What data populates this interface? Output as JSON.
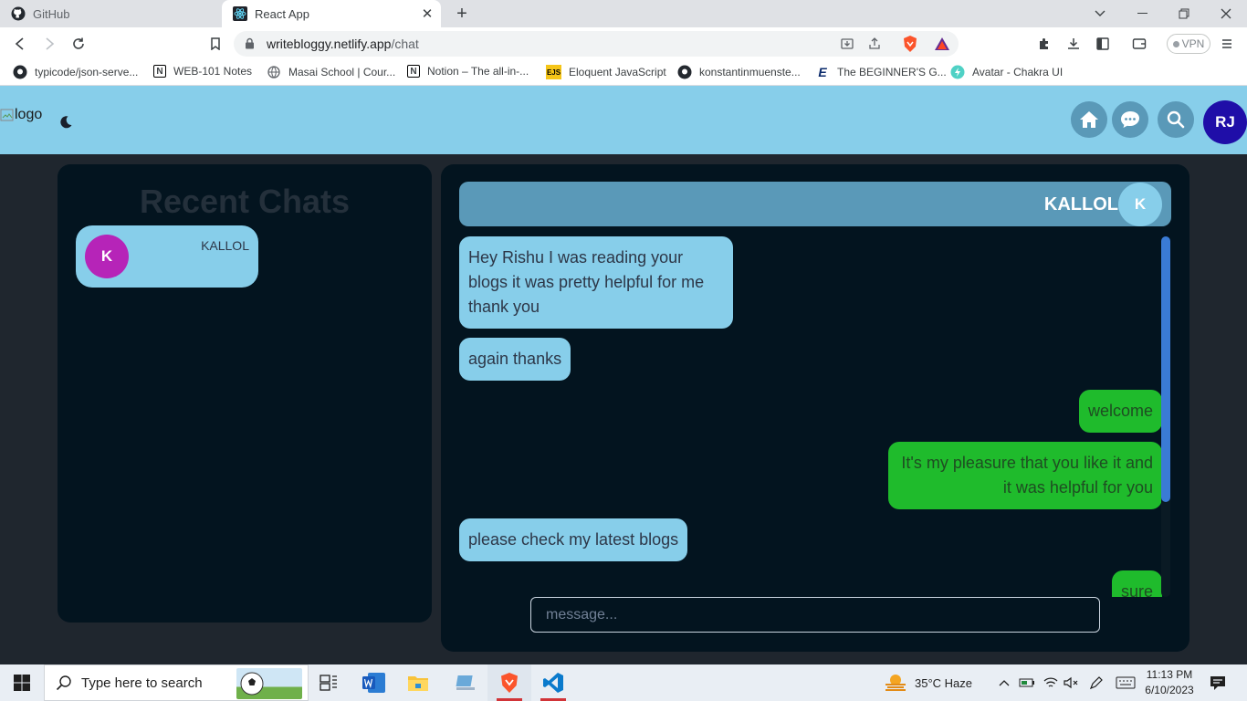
{
  "browser": {
    "tabs": [
      {
        "title": "GitHub",
        "icon": "github-icon",
        "active": false
      },
      {
        "title": "React App",
        "icon": "react-icon",
        "active": true
      }
    ],
    "url_host": "writebloggy.netlify.app",
    "url_path": "/chat",
    "vpn_label": "VPN",
    "bookmarks": [
      {
        "label": "typicode/json-serve...",
        "icon": "github-icon"
      },
      {
        "label": "WEB-101 Notes",
        "icon": "notion-icon"
      },
      {
        "label": "Masai School | Cour...",
        "icon": "globe-icon"
      },
      {
        "label": "Notion – The all-in-...",
        "icon": "notion-icon"
      },
      {
        "label": "Eloquent JavaScript",
        "icon": "ejs-icon"
      },
      {
        "label": "konstantinmuenste...",
        "icon": "github-icon"
      },
      {
        "label": "The BEGINNER'S G...",
        "icon": "e-icon"
      },
      {
        "label": "Avatar - Chakra UI",
        "icon": "chakra-icon"
      }
    ]
  },
  "app": {
    "logo_alt": "logo",
    "user_initials": "RJ",
    "recent_chats_title": "Recent Chats",
    "recent_chats": [
      {
        "initial": "K",
        "name": "KALLOL"
      }
    ],
    "active_chat": {
      "name": "KALLOL",
      "initial": "K",
      "messages": [
        {
          "from": "them",
          "text": "Hey Rishu I was reading your blogs it was pretty helpful for me thank you"
        },
        {
          "from": "them",
          "text": "again thanks"
        },
        {
          "from": "me",
          "text": "welcome"
        },
        {
          "from": "me",
          "text": "It's my pleasure that you like it and it was helpful for you"
        },
        {
          "from": "them",
          "text": "please check my latest blogs"
        },
        {
          "from": "me",
          "text": "sure"
        }
      ]
    },
    "message_placeholder": "message...",
    "message_value": ""
  },
  "colors": {
    "header_bg": "#87ceea",
    "panel_bg": "#03141f",
    "incoming_bubble": "#87ceea",
    "outgoing_bubble": "#1fbb2c",
    "avatar_k": "#b624b8",
    "avatar_rj": "#1f0ea8"
  },
  "taskbar": {
    "search_placeholder": "Type here to search",
    "weather": "35°C  Haze",
    "time": "11:13 PM",
    "date": "6/10/2023"
  }
}
